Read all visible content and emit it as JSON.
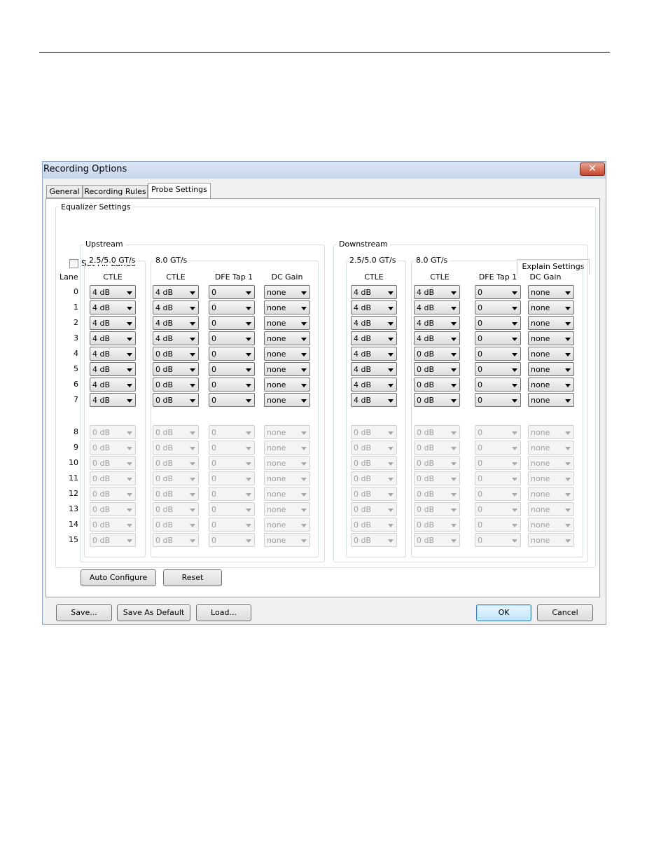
{
  "window": {
    "title": "Recording Options"
  },
  "tabs": [
    "General",
    "Recording Rules",
    "Probe Settings"
  ],
  "active_tab": "Probe Settings",
  "eq": {
    "title": "Equalizer Settings",
    "set_all_lanes": "Set All Lanes",
    "set_all_checked": false,
    "explain": "Explain Settings",
    "lane_header": "Lane",
    "upstream": "Upstream",
    "downstream": "Downstream",
    "rate_a": "2.5/5.0 GT/s",
    "rate_b": "8.0 GT/s",
    "col_ctle": "CTLE",
    "col_dfe": "DFE Tap 1",
    "col_dcgain": "DC Gain",
    "lanes": [
      "0",
      "1",
      "2",
      "3",
      "4",
      "5",
      "6",
      "7",
      "8",
      "9",
      "10",
      "11",
      "12",
      "13",
      "14",
      "15"
    ],
    "upstream_values": {
      "ctle_a": [
        "4 dB",
        "4 dB",
        "4 dB",
        "4 dB",
        "4 dB",
        "4 dB",
        "4 dB",
        "4 dB",
        "0 dB",
        "0 dB",
        "0 dB",
        "0 dB",
        "0 dB",
        "0 dB",
        "0 dB",
        "0 dB"
      ],
      "ctle_b": [
        "4 dB",
        "4 dB",
        "4 dB",
        "4 dB",
        "0 dB",
        "0 dB",
        "0 dB",
        "0 dB",
        "0 dB",
        "0 dB",
        "0 dB",
        "0 dB",
        "0 dB",
        "0 dB",
        "0 dB",
        "0 dB"
      ],
      "dfe": [
        "0",
        "0",
        "0",
        "0",
        "0",
        "0",
        "0",
        "0",
        "0",
        "0",
        "0",
        "0",
        "0",
        "0",
        "0",
        "0"
      ],
      "dcgain": [
        "none",
        "none",
        "none",
        "none",
        "none",
        "none",
        "none",
        "none",
        "none",
        "none",
        "none",
        "none",
        "none",
        "none",
        "none",
        "none"
      ]
    },
    "downstream_values": {
      "ctle_a": [
        "4 dB",
        "4 dB",
        "4 dB",
        "4 dB",
        "4 dB",
        "4 dB",
        "4 dB",
        "4 dB",
        "0 dB",
        "0 dB",
        "0 dB",
        "0 dB",
        "0 dB",
        "0 dB",
        "0 dB",
        "0 dB"
      ],
      "ctle_b": [
        "4 dB",
        "4 dB",
        "4 dB",
        "4 dB",
        "0 dB",
        "0 dB",
        "0 dB",
        "0 dB",
        "0 dB",
        "0 dB",
        "0 dB",
        "0 dB",
        "0 dB",
        "0 dB",
        "0 dB",
        "0 dB"
      ],
      "dfe": [
        "0",
        "0",
        "0",
        "0",
        "0",
        "0",
        "0",
        "0",
        "0",
        "0",
        "0",
        "0",
        "0",
        "0",
        "0",
        "0"
      ],
      "dcgain": [
        "none",
        "none",
        "none",
        "none",
        "none",
        "none",
        "none",
        "none",
        "none",
        "none",
        "none",
        "none",
        "none",
        "none",
        "none",
        "none"
      ]
    },
    "enabled_lanes": 8
  },
  "buttons": {
    "auto_configure": "Auto Configure",
    "reset": "Reset",
    "save": "Save...",
    "save_default": "Save As Default",
    "load": "Load...",
    "ok": "OK",
    "cancel": "Cancel"
  },
  "icons": {
    "close": "close-icon",
    "dropdown": "chevron-down-icon",
    "checkbox": "checkbox-icon"
  }
}
